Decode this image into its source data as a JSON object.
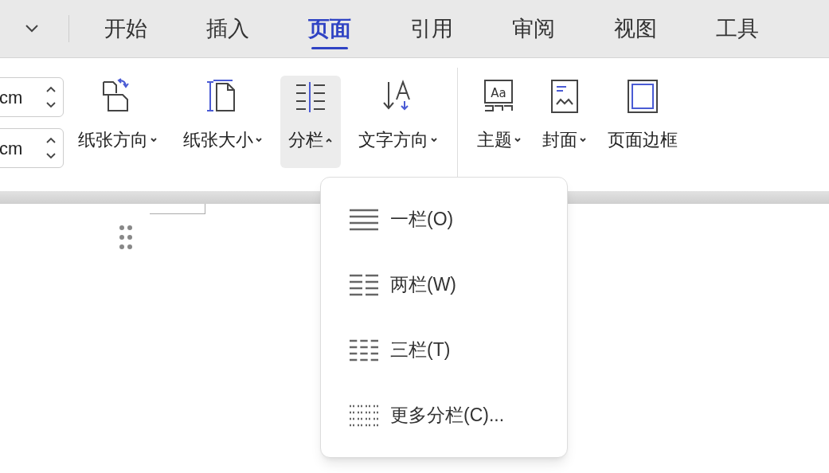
{
  "tabs": [
    {
      "label": "开始",
      "selected": false
    },
    {
      "label": "插入",
      "selected": false
    },
    {
      "label": "页面",
      "selected": true
    },
    {
      "label": "引用",
      "selected": false
    },
    {
      "label": "审阅",
      "selected": false
    },
    {
      "label": "视图",
      "selected": false
    },
    {
      "label": "工具",
      "selected": false
    }
  ],
  "fields": [
    {
      "value": "cm"
    },
    {
      "value": "cm"
    }
  ],
  "ribbon_groups": [
    [
      {
        "label": "纸张方向",
        "dropdown": true,
        "expanded": false
      },
      {
        "label": "纸张大小",
        "dropdown": true,
        "expanded": false
      },
      {
        "label": "分栏",
        "dropdown": true,
        "expanded": true
      },
      {
        "label": "文字方向",
        "dropdown": true,
        "expanded": false
      }
    ],
    [
      {
        "label": "主题",
        "dropdown": true,
        "expanded": false,
        "icon_text": "Aa"
      },
      {
        "label": "封面",
        "dropdown": true,
        "expanded": false
      },
      {
        "label": "页面边框",
        "dropdown": false,
        "expanded": false
      }
    ]
  ],
  "menu": [
    {
      "label": "一栏(O)"
    },
    {
      "label": "两栏(W)"
    },
    {
      "label": "三栏(T)"
    },
    {
      "label": "更多分栏(C)..."
    }
  ]
}
